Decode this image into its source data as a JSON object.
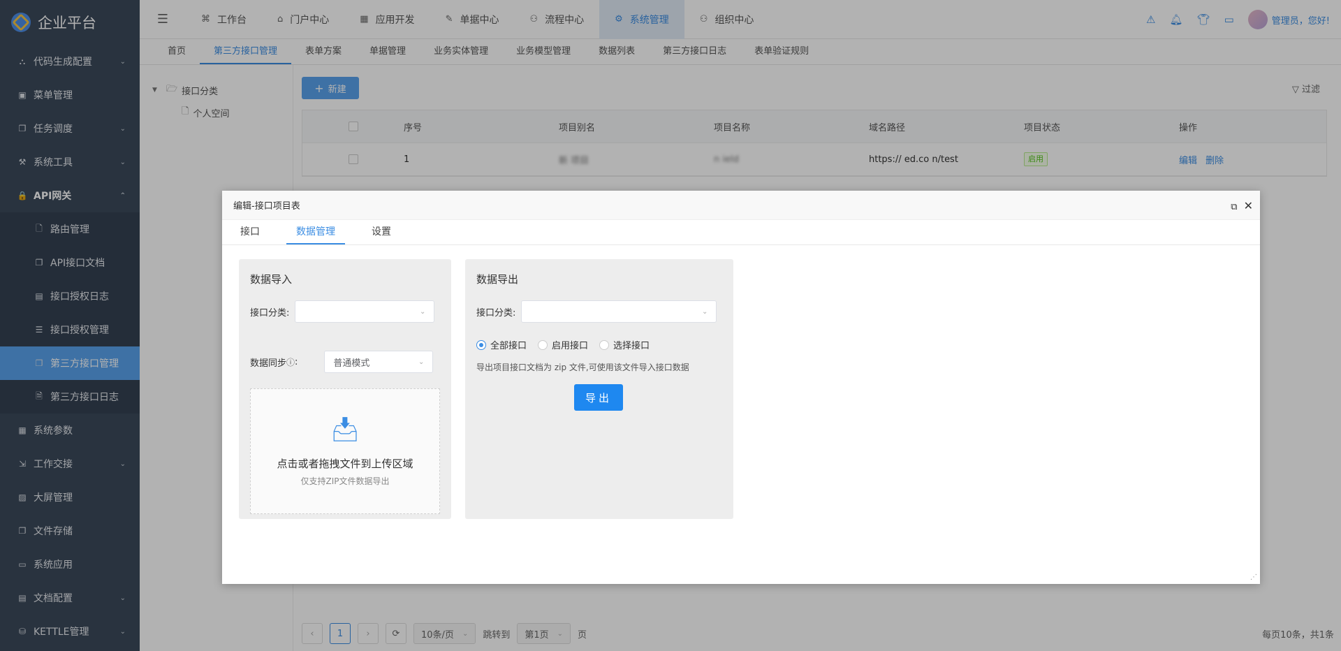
{
  "app": {
    "title": "企业平台"
  },
  "sidebar": {
    "items": [
      {
        "label": "代码生成配置",
        "icon": "tree-icon",
        "glyph": "⛬",
        "arrow": "⌄"
      },
      {
        "label": "菜单管理",
        "icon": "menu-icon",
        "glyph": "▣",
        "arrow": ""
      },
      {
        "label": "任务调度",
        "icon": "copy-icon",
        "glyph": "❐",
        "arrow": "⌄"
      },
      {
        "label": "系统工具",
        "icon": "wrench-icon",
        "glyph": "⚒",
        "arrow": "⌄"
      },
      {
        "label": "API网关",
        "icon": "lock-icon",
        "glyph": "🔒",
        "arrow": "⌃"
      }
    ],
    "subitems": [
      {
        "label": "路由管理",
        "icon": "file-icon",
        "glyph": "🗋"
      },
      {
        "label": "API接口文档",
        "icon": "copy-icon",
        "glyph": "❐"
      },
      {
        "label": "接口授权日志",
        "icon": "chart-icon",
        "glyph": "▤"
      },
      {
        "label": "接口授权管理",
        "icon": "list-icon",
        "glyph": "☰"
      },
      {
        "label": "第三方接口管理",
        "icon": "copy-icon",
        "glyph": "❐"
      },
      {
        "label": "第三方接口日志",
        "icon": "doc-search-icon",
        "glyph": "🗎"
      }
    ],
    "items2": [
      {
        "label": "系统参数",
        "icon": "grid-icon",
        "glyph": "▦",
        "arrow": ""
      },
      {
        "label": "工作交接",
        "icon": "handover-icon",
        "glyph": "⇲",
        "arrow": "⌄"
      },
      {
        "label": "大屏管理",
        "icon": "screen-icon",
        "glyph": "▨",
        "arrow": ""
      },
      {
        "label": "文件存储",
        "icon": "copy-icon",
        "glyph": "❐",
        "arrow": ""
      },
      {
        "label": "系统应用",
        "icon": "folder-icon",
        "glyph": "▭",
        "arrow": ""
      },
      {
        "label": "文档配置",
        "icon": "doc-icon",
        "glyph": "▤",
        "arrow": "⌄"
      },
      {
        "label": "KETTLE管理",
        "icon": "database-icon",
        "glyph": "⛁",
        "arrow": "⌄"
      }
    ]
  },
  "topnav": {
    "items": [
      {
        "label": "工作台",
        "glyph": "⌘"
      },
      {
        "label": "门户中心",
        "glyph": "⌂"
      },
      {
        "label": "应用开发",
        "glyph": "▦"
      },
      {
        "label": "单据中心",
        "glyph": "✎"
      },
      {
        "label": "流程中心",
        "glyph": "⚇"
      },
      {
        "label": "系统管理",
        "glyph": "⚙"
      },
      {
        "label": "组织中心",
        "glyph": "⚇"
      }
    ],
    "greeting": "管理员，您好!"
  },
  "subtabs": [
    "首页",
    "第三方接口管理",
    "表单方案",
    "单据管理",
    "业务实体管理",
    "业务模型管理",
    "数据列表",
    "第三方接口日志",
    "表单验证规则"
  ],
  "tree": {
    "root": "接口分类",
    "child": "个人空间"
  },
  "toolbar": {
    "new_label": "新建",
    "filter_label": "过滤"
  },
  "table": {
    "headers": [
      "序号",
      "项目别名",
      "项目名称",
      "域名路径",
      "项目状态",
      "操作"
    ],
    "rows": [
      {
        "index": "1",
        "alias": "新 项目",
        "name": "n      ield",
        "domain": "https://          ed.co     n/test",
        "status": "启用",
        "edit": "编辑",
        "delete": "删除"
      }
    ]
  },
  "pagination": {
    "current": "1",
    "page_size": "10条/页",
    "jump_label": "跳转到",
    "jump_value": "第1页",
    "page_suffix": "页",
    "summary": "每页10条，共1条"
  },
  "modal": {
    "title": "编辑-接口项目表",
    "tabs": [
      "接口",
      "数据管理",
      "设置"
    ],
    "import": {
      "title": "数据导入",
      "category_label": "接口分类:",
      "sync_label": "数据同步",
      "sync_suffix": ":",
      "sync_value": "普通模式",
      "upload_main": "点击或者拖拽文件到上传区域",
      "upload_tip": "仅支持ZIP文件数据导出"
    },
    "export": {
      "title": "数据导出",
      "category_label": "接口分类:",
      "options": [
        "全部接口",
        "启用接口",
        "选择接口"
      ],
      "hint": "导出项目接口文档为 zip 文件,可使用该文件导入接口数据",
      "button": "导出"
    }
  },
  "colors": {
    "accent": "#3b8de3",
    "sidebar": "#3c4a5b",
    "active_menu": "#5aa2ec"
  }
}
